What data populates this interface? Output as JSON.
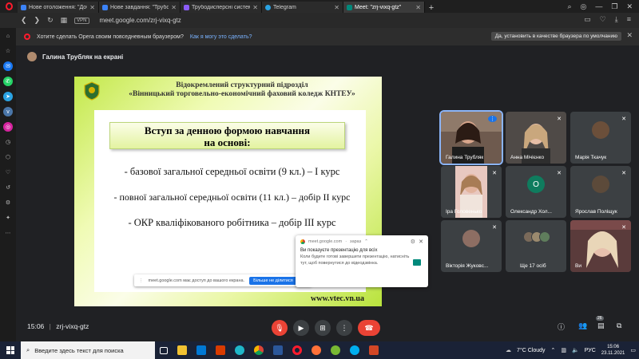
{
  "browser": {
    "tabs": [
      {
        "label": "Нове отоложення: \"Добр",
        "active": false,
        "color": "#3b82f6"
      },
      {
        "label": "Нове завдання: \"Трубоди",
        "active": false,
        "color": "#3b82f6"
      },
      {
        "label": "Трубодисперсні системи",
        "active": false,
        "color": "#8b5cf6"
      },
      {
        "label": "Telegram",
        "active": false,
        "color": "#2aa3e3"
      },
      {
        "label": "Meet: \"zrj-vixq-gtz\"",
        "active": true,
        "color": "#00897b"
      }
    ],
    "url": "meet.google.com/zrj-vixq-gtz",
    "vpn_label": "VPN"
  },
  "banner": {
    "text": "Хотите сделать Opera своим повседневным браузером?",
    "link": "Как я могу это сделать?",
    "button": "Да, установить в качестве браузера по умолчанию"
  },
  "meet": {
    "presenter_text": "Галина Трубляк на екрані",
    "slide": {
      "header_line1": "Відокремлений структурний підрозділ",
      "header_line2": "«Вінницький торговельно-економічний фаховий коледж КНТЕУ»",
      "box_line1": "Вступ за денною формою навчання",
      "box_line2": "на основі:",
      "line1": "- базової загальної середньої освіти (9 кл.) – I курс",
      "line2": "- повної загальної середньої освіти (11 кл.) – добір II курс",
      "line3": "- ОКР кваліфікованого робітника – добір III курс",
      "website": "www.vtec.vn.ua"
    },
    "share_bar": {
      "text": "meet.google.com має доступ до вашого екрана.",
      "button": "Більше не ділитися"
    },
    "notification": {
      "source": "meet.google.com",
      "time": "зараз",
      "title": "Ви показуєте презентацію для всіх",
      "body": "Коли будете готові завершити презентацію, натисніть тут, щоб повернутися до відеодзвінка."
    },
    "participants": [
      {
        "name": "Галина Трубляк",
        "photo": true,
        "speaking": true
      },
      {
        "name": "Анна Мічієнко",
        "photo": true,
        "speaking": false
      },
      {
        "name": "Марія Ткачук",
        "photo": false,
        "avatar_color": "#6b4f3a",
        "speaking": false
      },
      {
        "name": "Іра Головенько",
        "photo": true,
        "speaking": false
      },
      {
        "name": "Олександр Хол...",
        "photo": false,
        "avatar_letter": "О",
        "avatar_color": "#0f7c5e",
        "speaking": false
      },
      {
        "name": "Ярослав Поліщук",
        "photo": false,
        "avatar_color": "#5c4a3a",
        "speaking": false
      },
      {
        "name": "Вікторія Жуковс...",
        "photo": false,
        "avatar_color": "#8d6e63",
        "speaking": false
      },
      {
        "name": "Ще 17 осіб",
        "photo": false,
        "speaking": false
      },
      {
        "name": "Ви",
        "photo": true,
        "speaking": false
      }
    ],
    "bottom": {
      "time": "15:06",
      "separator": "|",
      "code": "zrj-vixq-gtz",
      "participants_badge": "26"
    }
  },
  "taskbar": {
    "search_placeholder": "Введите здесь текст для поиска",
    "weather": "7°C  Cloudy",
    "lang": "РУС",
    "time": "15:06",
    "date": "23.11.2021"
  },
  "colors": {
    "accent": "#8ab4f8",
    "end_call": "#ea4335",
    "mic_off": "#ea4335"
  }
}
